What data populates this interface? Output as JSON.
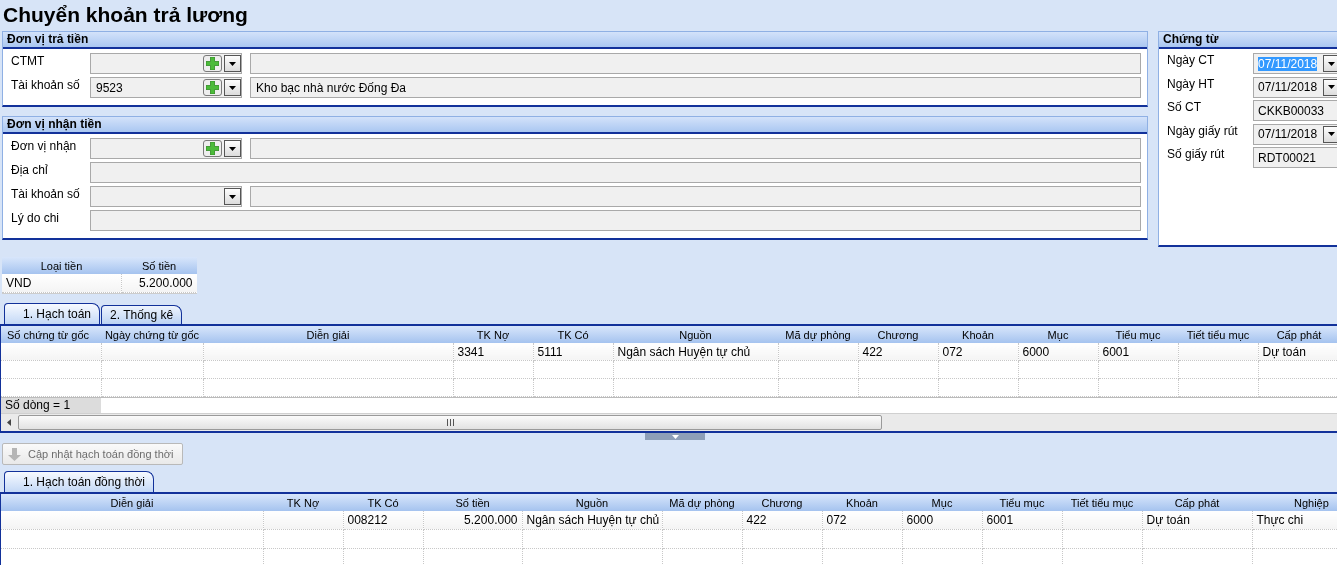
{
  "title": "Chuyển khoản trả lương",
  "payer": {
    "title": "Đơn vị trả tiền",
    "rows": [
      {
        "label": "CTMT",
        "kind": "lookup"
      },
      {
        "label": "Tài khoản số",
        "kind": "lookup",
        "value": "9523",
        "name": "Kho bạc nhà nước Đống Đa"
      }
    ]
  },
  "payee": {
    "title": "Đơn vị nhận tiền",
    "rows": [
      {
        "label": "Đơn vị nhận",
        "kind": "lookup"
      },
      {
        "label": "Địa chỉ",
        "kind": "text"
      },
      {
        "label": "Tài khoản số",
        "kind": "combo"
      },
      {
        "label": "Lý do chi",
        "kind": "text"
      }
    ]
  },
  "voucher": {
    "title": "Chứng từ",
    "fields": [
      {
        "label": "Ngày CT",
        "kind": "date",
        "value": "07/11/2018",
        "highlighted": true
      },
      {
        "label": "Ngày HT",
        "kind": "date",
        "value": "07/11/2018",
        "highlighted": false
      },
      {
        "label": "Số CT",
        "kind": "text",
        "value": "CKKB00033",
        "highlighted": false
      },
      {
        "label": "Ngày giấy rút",
        "kind": "date",
        "value": "07/11/2018",
        "highlighted": false
      },
      {
        "label": "Số giấy rút",
        "kind": "text",
        "value": "RDT00021",
        "highlighted": false
      }
    ]
  },
  "currency_grid": {
    "columns": [
      {
        "label": "Loại tiền"
      },
      {
        "label": "Số tiền",
        "numeric": true
      }
    ],
    "rows": [
      [
        "VND",
        "5.200.000"
      ]
    ]
  },
  "main_tabs": [
    {
      "label": "1. Hạch toán",
      "selected": true
    },
    {
      "label": "2. Thống kê",
      "selected": false
    }
  ],
  "accounting_grid": {
    "columns": [
      {
        "label": "Số chứng từ gốc"
      },
      {
        "label": "Ngày chứng từ gốc"
      },
      {
        "label": "Diễn giải"
      },
      {
        "label": "TK Nợ"
      },
      {
        "label": "TK Có"
      },
      {
        "label": "Nguồn"
      },
      {
        "label": "Mã dự phòng"
      },
      {
        "label": "Chương"
      },
      {
        "label": "Khoản"
      },
      {
        "label": "Mục"
      },
      {
        "label": "Tiểu mục"
      },
      {
        "label": "Tiết tiểu mục"
      },
      {
        "label": "Cấp phát"
      }
    ],
    "rows": [
      [
        null,
        null,
        null,
        "3341",
        "5111",
        "Ngân sách Huyện tự chủ",
        null,
        "422",
        "072",
        "6000",
        "6001",
        null,
        "Dự toán"
      ]
    ],
    "row_count": "Số dòng = 1"
  },
  "update_button": {
    "label": "Cập nhật hạch toán đồng thời",
    "disabled": true
  },
  "sub_tabs": [
    {
      "label": "1. Hạch toán đồng thời",
      "selected": true
    }
  ],
  "concurrent_grid": {
    "columns": [
      {
        "label": "Diễn giải"
      },
      {
        "label": "TK Nợ"
      },
      {
        "label": "TK Có"
      },
      {
        "label": "Số tiền",
        "numeric": true
      },
      {
        "label": "Nguồn"
      },
      {
        "label": "Mã dự phòng"
      },
      {
        "label": "Chương"
      },
      {
        "label": "Khoản"
      },
      {
        "label": "Mục"
      },
      {
        "label": "Tiểu mục"
      },
      {
        "label": "Tiết tiểu mục"
      },
      {
        "label": "Cấp phát"
      },
      {
        "label": "Nghiệp"
      }
    ],
    "rows": [
      [
        null,
        null,
        "008212",
        "5.200.000",
        "Ngân sách Huyện tự chủ",
        null,
        "422",
        "072",
        "6000",
        "6001",
        null,
        "Dự toán",
        "Thực chi"
      ]
    ]
  }
}
